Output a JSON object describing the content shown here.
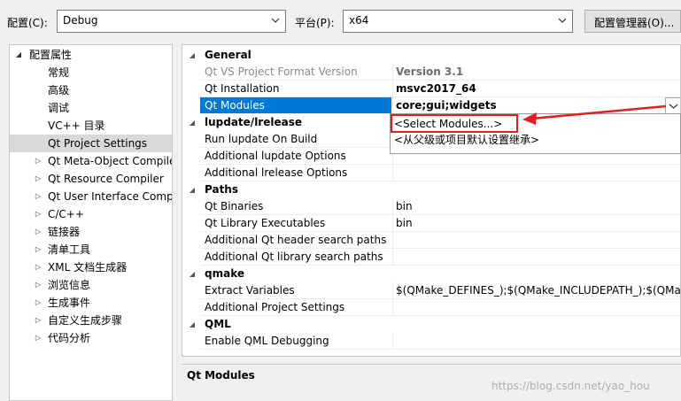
{
  "topbar": {
    "config_label": "配置(C):",
    "config_value": "Debug",
    "platform_label": "平台(P):",
    "platform_value": "x64",
    "manager_button": "配置管理器(O)..."
  },
  "tree": {
    "root": "配置属性",
    "items": [
      {
        "label": "常规",
        "expandable": false
      },
      {
        "label": "高级",
        "expandable": false
      },
      {
        "label": "调试",
        "expandable": false
      },
      {
        "label": "VC++ 目录",
        "expandable": false
      },
      {
        "label": "Qt Project Settings",
        "expandable": false,
        "selected": true
      },
      {
        "label": "Qt Meta-Object Compile",
        "expandable": true
      },
      {
        "label": "Qt Resource Compiler",
        "expandable": true
      },
      {
        "label": "Qt User Interface Comp",
        "expandable": true
      },
      {
        "label": "C/C++",
        "expandable": true
      },
      {
        "label": "链接器",
        "expandable": true
      },
      {
        "label": "清单工具",
        "expandable": true
      },
      {
        "label": "XML 文档生成器",
        "expandable": true
      },
      {
        "label": "浏览信息",
        "expandable": true
      },
      {
        "label": "生成事件",
        "expandable": true
      },
      {
        "label": "自定义生成步骤",
        "expandable": true
      },
      {
        "label": "代码分析",
        "expandable": true
      }
    ]
  },
  "grid": {
    "rows": [
      {
        "type": "cat",
        "name": "General"
      },
      {
        "type": "prop",
        "name": "Qt VS Project Format Version",
        "value": "Version 3.1",
        "disabled": true,
        "bold": true
      },
      {
        "type": "prop",
        "name": "Qt Installation",
        "value": "msvc2017_64",
        "bold": true
      },
      {
        "type": "prop",
        "name": "Qt Modules",
        "value": "core;gui;widgets",
        "bold": true,
        "selected": true
      },
      {
        "type": "cat",
        "name": "lupdate/lrelease"
      },
      {
        "type": "prop",
        "name": "Run lupdate On Build",
        "value": ""
      },
      {
        "type": "prop",
        "name": "Additional lupdate Options",
        "value": ""
      },
      {
        "type": "prop",
        "name": "Additional lrelease Options",
        "value": ""
      },
      {
        "type": "cat",
        "name": "Paths"
      },
      {
        "type": "prop",
        "name": "Qt Binaries",
        "value": "bin"
      },
      {
        "type": "prop",
        "name": "Qt Library Executables",
        "value": "bin"
      },
      {
        "type": "prop",
        "name": "Additional Qt header search paths",
        "value": ""
      },
      {
        "type": "prop",
        "name": "Additional Qt library search paths",
        "value": ""
      },
      {
        "type": "cat",
        "name": "qmake"
      },
      {
        "type": "prop",
        "name": "Extract Variables",
        "value": "$(QMake_DEFINES_);$(QMake_INCLUDEPATH_);$(QMake_"
      },
      {
        "type": "prop",
        "name": "Additional Project Settings",
        "value": ""
      },
      {
        "type": "cat",
        "name": "QML"
      },
      {
        "type": "prop",
        "name": "Enable QML Debugging",
        "value": ""
      }
    ]
  },
  "dropdown": {
    "options": [
      "<Select Modules...>",
      "<从父级或项目默认设置继承>"
    ]
  },
  "description": {
    "title": "Qt Modules"
  },
  "watermark": "https://blog.csdn.net/yao_hou",
  "colors": {
    "selection": "#0078d7",
    "annotation": "#e02020"
  }
}
